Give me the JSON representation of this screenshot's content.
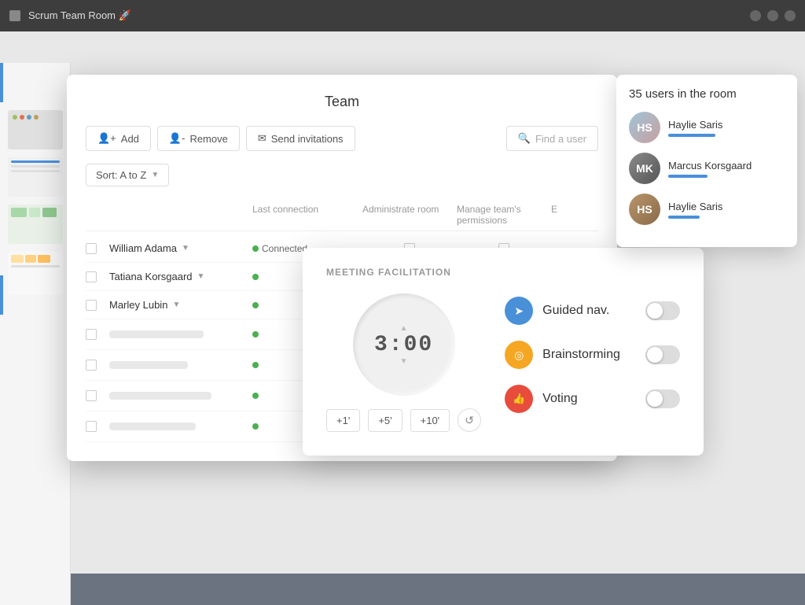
{
  "titlebar": {
    "title": "Scrum Team Room 🚀",
    "icon": "▣"
  },
  "team_modal": {
    "title": "Team",
    "buttons": {
      "add": "Add",
      "remove": "Remove",
      "send_invitations": "Send invitations",
      "find_placeholder": "Find a user"
    },
    "sort": {
      "label": "Sort: A to Z"
    },
    "table": {
      "headers": {
        "last_connection": "Last connection",
        "administrate_room": "Administrate room",
        "manage_permissions": "Manage team's permissions",
        "edit": "E"
      },
      "rows": [
        {
          "name": "William Adama",
          "status": "Connected",
          "connected": true
        },
        {
          "name": "Tatiana Korsgaard",
          "status": "",
          "connected": true
        },
        {
          "name": "Marley Lubin",
          "status": "",
          "connected": true
        },
        {
          "name": "",
          "status": "",
          "connected": true
        },
        {
          "name": "",
          "status": "",
          "connected": true
        },
        {
          "name": "",
          "status": "",
          "connected": true
        },
        {
          "name": "",
          "status": "",
          "connected": true
        }
      ]
    }
  },
  "users_panel": {
    "title": "35 users in the room",
    "users": [
      {
        "name": "Haylie Saris",
        "initials": "HS",
        "avatar_color": "1"
      },
      {
        "name": "Marcus Korsgaard",
        "initials": "MK",
        "avatar_color": "2"
      },
      {
        "name": "Haylie Saris",
        "initials": "HS",
        "avatar_color": "3"
      }
    ]
  },
  "meeting_panel": {
    "title": "MEETING FACILITATION",
    "timer": {
      "display": "3:00",
      "btn_plus1": "+1'",
      "btn_plus5": "+5'",
      "btn_plus10": "+10'",
      "reset_icon": "↺"
    },
    "features": [
      {
        "name": "Guided nav.",
        "icon": "➤",
        "icon_color": "blue",
        "enabled": false
      },
      {
        "name": "Brainstorming",
        "icon": "◎",
        "icon_color": "yellow",
        "enabled": false
      },
      {
        "name": "Voting",
        "icon": "👍",
        "icon_color": "red",
        "enabled": false
      }
    ]
  }
}
